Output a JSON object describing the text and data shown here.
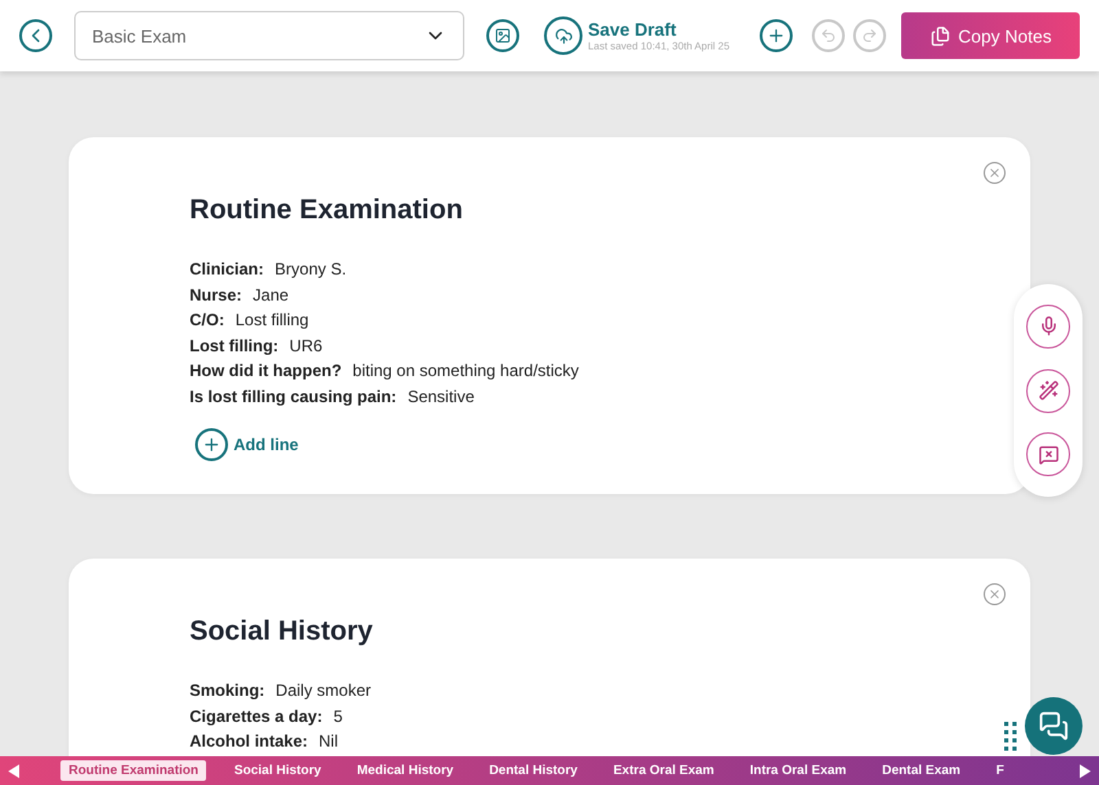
{
  "header": {
    "template": "Basic Exam",
    "save_label": "Save Draft",
    "last_saved": "Last saved 10:41, 30th April 25",
    "copy_label": "Copy Notes"
  },
  "sections": [
    {
      "title": "Routine Examination",
      "rows": [
        {
          "label": "Clinician:",
          "value": "Bryony S."
        },
        {
          "label": "Nurse:",
          "value": "Jane"
        },
        {
          "label": "C/O:",
          "value": "Lost filling"
        },
        {
          "label": "Lost filling:",
          "value": "UR6"
        },
        {
          "label": "How did it happen?",
          "value": "biting on something hard/sticky"
        },
        {
          "label": "Is lost filling causing pain:",
          "value": "Sensitive"
        }
      ],
      "add_label": "Add line"
    },
    {
      "title": "Social History",
      "rows": [
        {
          "label": "Smoking:",
          "value": "Daily smoker"
        },
        {
          "label": "Cigarettes a day:",
          "value": "5"
        },
        {
          "label": "Alcohol intake:",
          "value": "Nil"
        }
      ]
    }
  ],
  "tabs": [
    {
      "label": "Routine Examination",
      "selected": true
    },
    {
      "label": "Social History",
      "selected": false
    },
    {
      "label": "Medical History",
      "selected": false
    },
    {
      "label": "Dental History",
      "selected": false
    },
    {
      "label": "Extra Oral Exam",
      "selected": false
    },
    {
      "label": "Intra Oral Exam",
      "selected": false
    },
    {
      "label": "Dental Exam",
      "selected": false
    },
    {
      "label": "F",
      "selected": false
    }
  ]
}
